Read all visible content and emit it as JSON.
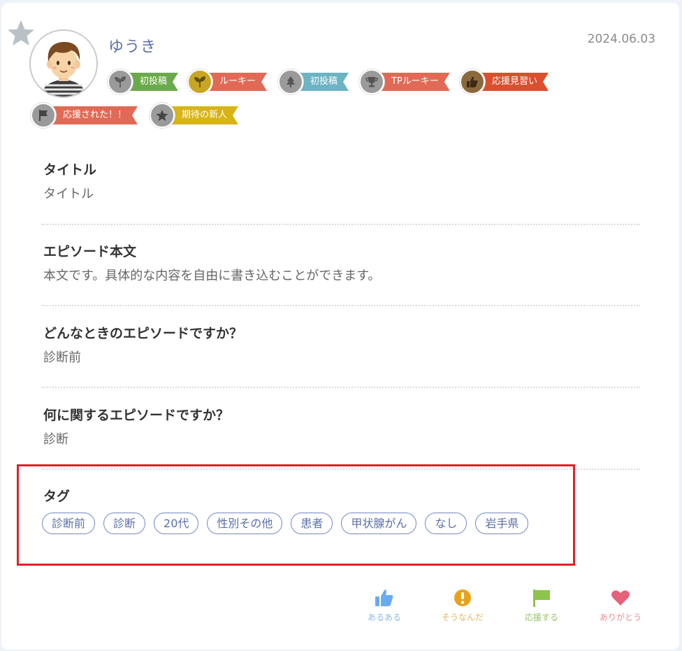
{
  "post": {
    "username": "ゆうき",
    "date": "2024.06.03"
  },
  "badges": [
    {
      "label": "初投稿",
      "icon": "sprout-icon",
      "ribbon_color": "#6aaa4a",
      "icon_bg": "#9a9a9a"
    },
    {
      "label": "ルーキー",
      "icon": "sprout-icon",
      "ribbon_color": "#e06a55",
      "icon_bg": "#c8a623"
    },
    {
      "label": "初投稿",
      "icon": "tree-icon",
      "ribbon_color": "#6ab4c4",
      "icon_bg": "#9a9a9a"
    },
    {
      "label": "TPルーキー",
      "icon": "trophy-icon",
      "ribbon_color": "#e06a55",
      "icon_bg": "#9a9a9a"
    },
    {
      "label": "応援見習い",
      "icon": "thumbs-up-icon",
      "ribbon_color": "#d9502e",
      "icon_bg": "#8a6a3c"
    },
    {
      "label": "応援された！！",
      "icon": "flag-icon",
      "ribbon_color": "#e06a55",
      "icon_bg": "#9a9a9a"
    },
    {
      "label": "期待の新人",
      "icon": "star-icon",
      "ribbon_color": "#d8b415",
      "icon_bg": "#9a9a9a"
    }
  ],
  "sections": {
    "title": {
      "heading": "タイトル",
      "value": "タイトル"
    },
    "body": {
      "heading": "エピソード本文",
      "value": "本文です。具体的な内容を自由に書き込むことができます。"
    },
    "when": {
      "heading": "どんなときのエピソードですか？",
      "value": "診断前"
    },
    "about": {
      "heading": "何に関するエピソードですか？",
      "value": "診断"
    },
    "tags": {
      "heading": "タグ",
      "items": [
        "診断前",
        "診断",
        "20代",
        "性別その他",
        "患者",
        "甲状腺がん",
        "なし",
        "岩手県"
      ]
    }
  },
  "reactions": [
    {
      "label": "あるある",
      "icon": "thumbs-up-icon",
      "color": "#6aaaf0"
    },
    {
      "label": "そうなんだ",
      "icon": "exclamation-icon",
      "color": "#e8a21a"
    },
    {
      "label": "応援する",
      "icon": "flag-icon",
      "color": "#8ec44a"
    },
    {
      "label": "ありがとう",
      "icon": "heart-icon",
      "color": "#e5627c"
    }
  ],
  "colors": {
    "accent": "#5b6fa8",
    "highlight_box": "#e0212b"
  }
}
